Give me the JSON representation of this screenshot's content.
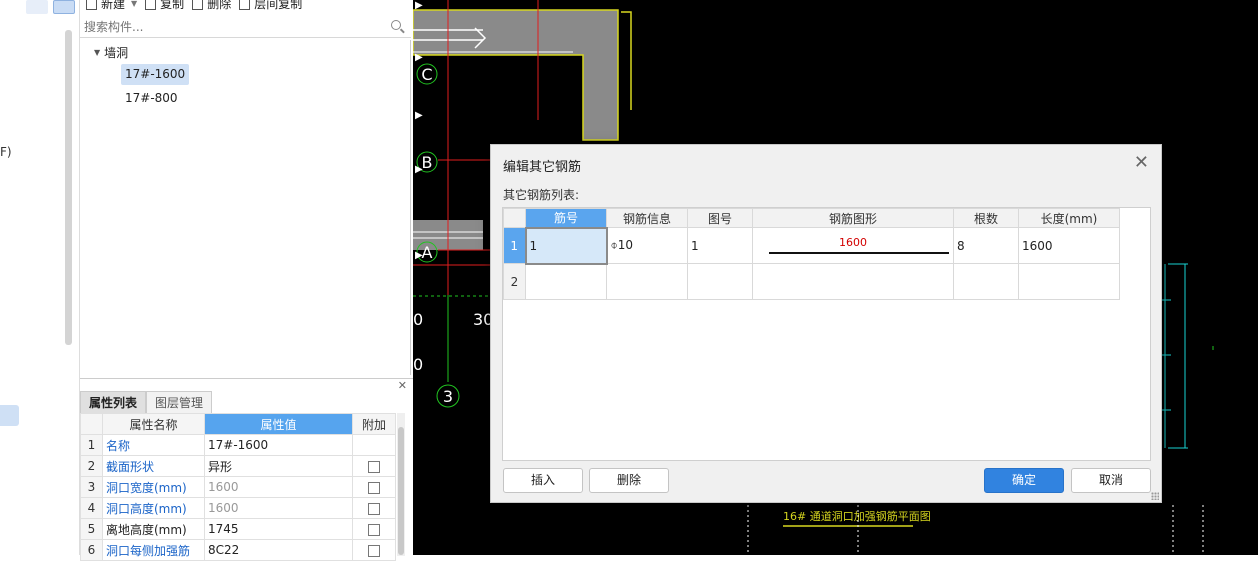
{
  "left_strip": {
    "label_rf": "F)"
  },
  "toolbar": {
    "new_label": "新建",
    "copy_label": "复制",
    "delete_label": "删除",
    "floor_copy_label": "层间复制"
  },
  "search": {
    "placeholder": "搜索构件..."
  },
  "tree": {
    "group_label": "墙洞",
    "items": [
      {
        "label": "17#-1600",
        "selected": true
      },
      {
        "label": "17#-800",
        "selected": false
      }
    ]
  },
  "props": {
    "tabs": [
      {
        "label": "属性列表",
        "active": true
      },
      {
        "label": "图层管理",
        "active": false
      }
    ],
    "headers": {
      "name": "属性名称",
      "value": "属性值",
      "extra": "附加"
    },
    "rows": [
      {
        "num": "1",
        "name": "名称",
        "value": "17#-1600",
        "blue": true,
        "gray": false,
        "checkbox": false
      },
      {
        "num": "2",
        "name": "截面形状",
        "value": "异形",
        "blue": true,
        "gray": false,
        "checkbox": true
      },
      {
        "num": "3",
        "name": "洞口宽度(mm)",
        "value": "1600",
        "blue": true,
        "gray": true,
        "checkbox": true
      },
      {
        "num": "4",
        "name": "洞口高度(mm)",
        "value": "1600",
        "blue": true,
        "gray": true,
        "checkbox": true
      },
      {
        "num": "5",
        "name": "离地高度(mm)",
        "value": "1745",
        "blue": false,
        "gray": false,
        "checkbox": true
      },
      {
        "num": "6",
        "name": "洞口每侧加强筋",
        "value": "8C22",
        "blue": true,
        "gray": false,
        "checkbox": true
      }
    ]
  },
  "cad": {
    "axis_labels": {
      "c": "C",
      "b": "B",
      "a": "A",
      "n3": "3",
      "left0a": "0",
      "n30": "30",
      "left0b": "0"
    },
    "drawing_title": "16#  通道洞口加强钢筋平面图"
  },
  "dialog": {
    "title": "编辑其它钢筋",
    "subtitle": "其它钢筋列表:",
    "columns": [
      "筋号",
      "钢筋信息",
      "图号",
      "钢筋图形",
      "根数",
      "长度(mm)"
    ],
    "rows": [
      {
        "row_num": "1",
        "bar_no": "1",
        "rebar_info": "⌽10",
        "fig_no": "1",
        "shape_label": "1600",
        "count": "8",
        "length": "1600"
      },
      {
        "row_num": "2",
        "bar_no": "",
        "rebar_info": "",
        "fig_no": "",
        "shape_label": "",
        "count": "",
        "length": ""
      }
    ],
    "buttons": {
      "insert": "插入",
      "delete": "删除",
      "ok": "确定",
      "cancel": "取消"
    }
  },
  "colors": {
    "accent": "#3183e0",
    "header_active": "#5aa5ee",
    "cad_background": "#000000",
    "cad_green": "#21c421",
    "cad_cyan": "#19d3d3",
    "cad_red": "#e01e1e",
    "cad_yellow": "#d8d820"
  }
}
